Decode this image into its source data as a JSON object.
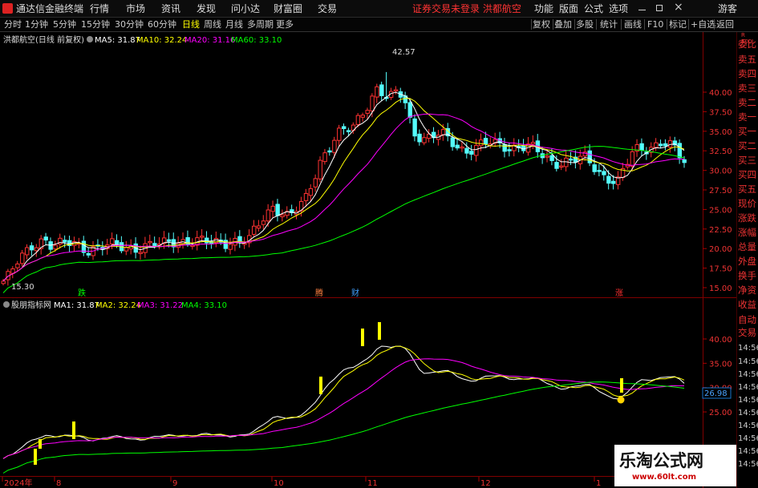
{
  "menubar": {
    "app_name": "通达信金融终端",
    "items": [
      "行情",
      "市场",
      "资讯",
      "发现",
      "问小达",
      "财富圈",
      "交易"
    ],
    "status": "证券交易未登录 洪都航空",
    "right": [
      "功能",
      "版面",
      "公式",
      "选项"
    ],
    "guest": "游客"
  },
  "toolbar": {
    "periods": [
      "分时",
      "1分钟",
      "5分钟",
      "15分钟",
      "30分钟",
      "60分钟",
      "日线",
      "周线",
      "月线",
      "多周期",
      "更多"
    ],
    "active_period": "日线",
    "right": [
      "复权",
      "叠加",
      "多股",
      "统计",
      "画线",
      "F10",
      "标记",
      "+自选",
      "返回"
    ]
  },
  "main_chart": {
    "title": "洪都航空(日线 前复权)",
    "mas": [
      {
        "label": "MA5: 31.87",
        "color": "#ffffff"
      },
      {
        "label": "MA10: 32.24",
        "color": "#ffff00"
      },
      {
        "label": "MA20: 31.16",
        "color": "#ff00ff"
      },
      {
        "label": "MA60: 33.10",
        "color": "#00ff00"
      }
    ],
    "high_label": "42.57",
    "low_label": "15.30",
    "y_ticks": [
      "40.00",
      "37.50",
      "35.00",
      "32.50",
      "30.00",
      "27.50",
      "25.00",
      "22.50",
      "20.00",
      "17.50",
      "15.00"
    ],
    "markers": [
      {
        "text": "跌",
        "color": "#00ff00"
      },
      {
        "text": "腾",
        "color": "#ff8040"
      },
      {
        "text": "财",
        "color": "#40a0ff"
      },
      {
        "text": "涨",
        "color": "#ff3030"
      }
    ]
  },
  "indicator": {
    "title": "股朋指标网",
    "mas": [
      {
        "label": "MA1: 31.87",
        "color": "#ffffff"
      },
      {
        "label": "MA2: 32.24",
        "color": "#ffff00"
      },
      {
        "label": "MA3: 31.22",
        "color": "#ff00ff"
      },
      {
        "label": "MA4: 33.10",
        "color": "#00ff00"
      }
    ],
    "y_ticks": [
      "40.00",
      "35.00",
      "30.00",
      "25.00"
    ],
    "current_value": "26.98"
  },
  "x_axis": [
    "2024年",
    "8",
    "9",
    "10",
    "11",
    "12",
    "1"
  ],
  "sidebar": {
    "r_tag": "R",
    "r_num": "500",
    "items": [
      "委比",
      "卖五",
      "卖四",
      "卖三",
      "卖二",
      "卖一",
      "买一",
      "买二",
      "买三",
      "买四",
      "买五",
      "现价",
      "涨跌",
      "涨幅",
      "总量",
      "外盘",
      "换手",
      "净资",
      "收益"
    ],
    "lower": [
      "自动",
      "交易"
    ],
    "times": [
      "14:56",
      "14:56",
      "14:56",
      "14:56",
      "14:56",
      "14:56",
      "14:56",
      "14:56",
      "14:56",
      "14:56"
    ]
  },
  "watermark": {
    "text": "乐淘公式网",
    "url": "www.60lt.com"
  },
  "colors": {
    "up": "#ff3232",
    "down": "#54fcfc",
    "ma5": "#ffffff",
    "ma10": "#ffff00",
    "ma20": "#ff00ff",
    "ma60": "#00ff00"
  }
}
